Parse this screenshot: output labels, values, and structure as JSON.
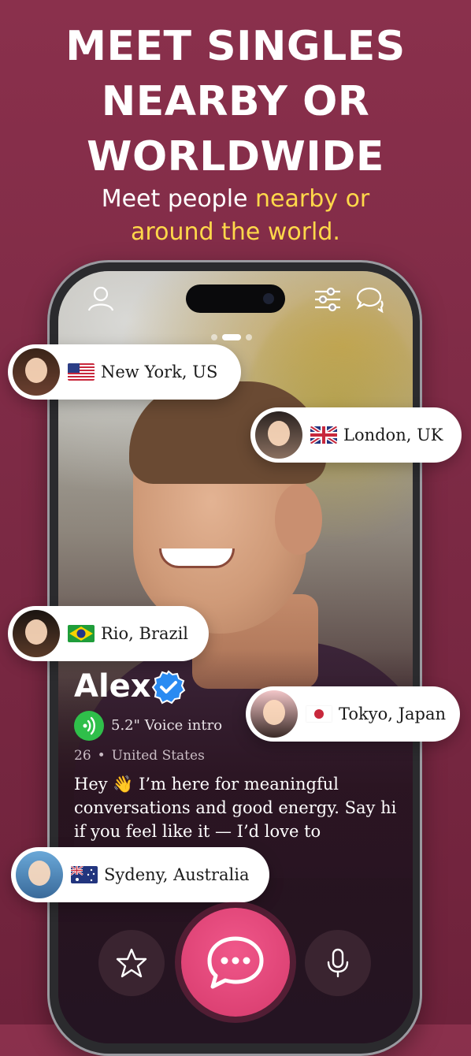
{
  "hero": {
    "headline_line1": "MEET SINGLES",
    "headline_line2": "NEARBY OR",
    "headline_line3": "WORLDWIDE",
    "subhead_plain": "Meet people ",
    "subhead_highlight1": "nearby or",
    "subhead_highlight2": "around the world."
  },
  "colors": {
    "background": "#7d2a45",
    "highlight": "#ffd84a",
    "accent": "#e0457a",
    "voice_green": "#2fbf4a",
    "verified_blue": "#2a8bf2"
  },
  "top_bar": {
    "profile_icon": "user-icon",
    "filter_icon": "sliders-icon",
    "messages_icon": "chat-bubbles-icon"
  },
  "locations": [
    {
      "label": "New York, US",
      "flag": "us-flag-icon"
    },
    {
      "label": "London, UK",
      "flag": "uk-flag-icon"
    },
    {
      "label": "Rio, Brazil",
      "flag": "brazil-flag-icon"
    },
    {
      "label": "Tokyo, Japan",
      "flag": "japan-flag-icon"
    },
    {
      "label": "Sydeny, Australia",
      "flag": "australia-flag-icon"
    }
  ],
  "profile": {
    "name": "Alex",
    "voice_intro": "5.2\" Voice intro",
    "age": "26",
    "country": "United States",
    "bio": "Hey 👋 I’m here for meaningful conversations and good energy. Say hi if you feel like it — I’d love to connect."
  },
  "actions": {
    "favorite_icon": "star-icon",
    "chat_icon": "chat-bubble-icon",
    "voice_icon": "microphone-icon"
  }
}
